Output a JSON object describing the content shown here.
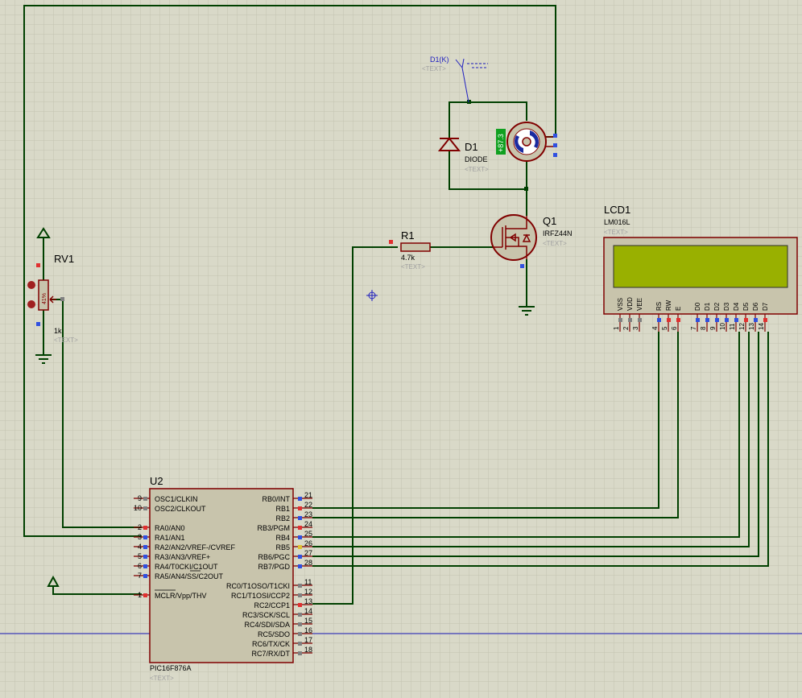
{
  "colors": {
    "background": "#d9d9c8",
    "grid": "#c2c2b0",
    "wire": "#004000",
    "component_body": "#c8c4ac",
    "component_outline": "#800000",
    "lcd_screen": "#99b000",
    "pin_red": "#e03030",
    "pin_blue": "#3050e0",
    "text_dark": "#000000",
    "text_placeholder": "#a0a0a0",
    "probe_blue": "#2020c0"
  },
  "probe": {
    "label": "D1(K)",
    "text": "<TEXT>"
  },
  "diode": {
    "ref": "D1",
    "value": "DIODE",
    "text": "<TEXT>"
  },
  "motor": {
    "readout": "+87.3"
  },
  "mosfet": {
    "ref": "Q1",
    "value": "IRFZ44N",
    "text": "<TEXT>"
  },
  "resistor": {
    "ref": "R1",
    "value": "4.7k",
    "text": "<TEXT>"
  },
  "pot": {
    "ref": "RV1",
    "value": "1k",
    "text": "<TEXT>",
    "position": "41%"
  },
  "lcd": {
    "ref": "LCD1",
    "value": "LM016L",
    "text": "<TEXT>",
    "pins": [
      {
        "name": "VSS",
        "num": "1"
      },
      {
        "name": "VDD",
        "num": "2"
      },
      {
        "name": "VEE",
        "num": "3"
      },
      {
        "name": "RS",
        "num": "4"
      },
      {
        "name": "RW",
        "num": "5"
      },
      {
        "name": "E",
        "num": "6"
      },
      {
        "name": "D0",
        "num": "7"
      },
      {
        "name": "D1",
        "num": "8"
      },
      {
        "name": "D2",
        "num": "9"
      },
      {
        "name": "D3",
        "num": "10"
      },
      {
        "name": "D4",
        "num": "11"
      },
      {
        "name": "D5",
        "num": "12"
      },
      {
        "name": "D6",
        "num": "13"
      },
      {
        "name": "D7",
        "num": "14"
      }
    ]
  },
  "mcu": {
    "ref": "U2",
    "part": "PIC16F876A",
    "text": "<TEXT>",
    "left_pins": [
      {
        "num": "9",
        "label": "OSC1/CLKIN"
      },
      {
        "num": "10",
        "label": "OSC2/CLKOUT"
      },
      {
        "num": "2",
        "label": "RA0/AN0"
      },
      {
        "num": "3",
        "label": "RA1/AN1"
      },
      {
        "num": "4",
        "label": "RA2/AN2/VREF-/CVREF"
      },
      {
        "num": "5",
        "label": "RA3/AN3/VREF+"
      },
      {
        "num": "6",
        "label": "RA4/T0CKI/C1OUT"
      },
      {
        "num": "7",
        "label": "RA5/AN4/SS/C2OUT"
      },
      {
        "num": "1",
        "label": "MCLR/Vpp/THV"
      }
    ],
    "right_pins": [
      {
        "num": "21",
        "label": "RB0/INT"
      },
      {
        "num": "22",
        "label": "RB1"
      },
      {
        "num": "23",
        "label": "RB2"
      },
      {
        "num": "24",
        "label": "RB3/PGM"
      },
      {
        "num": "25",
        "label": "RB4"
      },
      {
        "num": "26",
        "label": "RB5"
      },
      {
        "num": "27",
        "label": "RB6/PGC"
      },
      {
        "num": "28",
        "label": "RB7/PGD"
      },
      {
        "num": "11",
        "label": "RC0/T1OSO/T1CKI"
      },
      {
        "num": "12",
        "label": "RC1/T1OSI/CCP2"
      },
      {
        "num": "13",
        "label": "RC2/CCP1"
      },
      {
        "num": "14",
        "label": "RC3/SCK/SCL"
      },
      {
        "num": "15",
        "label": "RC4/SDI/SDA"
      },
      {
        "num": "16",
        "label": "RC5/SDO"
      },
      {
        "num": "17",
        "label": "RC6/TX/CK"
      },
      {
        "num": "18",
        "label": "RC7/RX/DT"
      }
    ]
  }
}
